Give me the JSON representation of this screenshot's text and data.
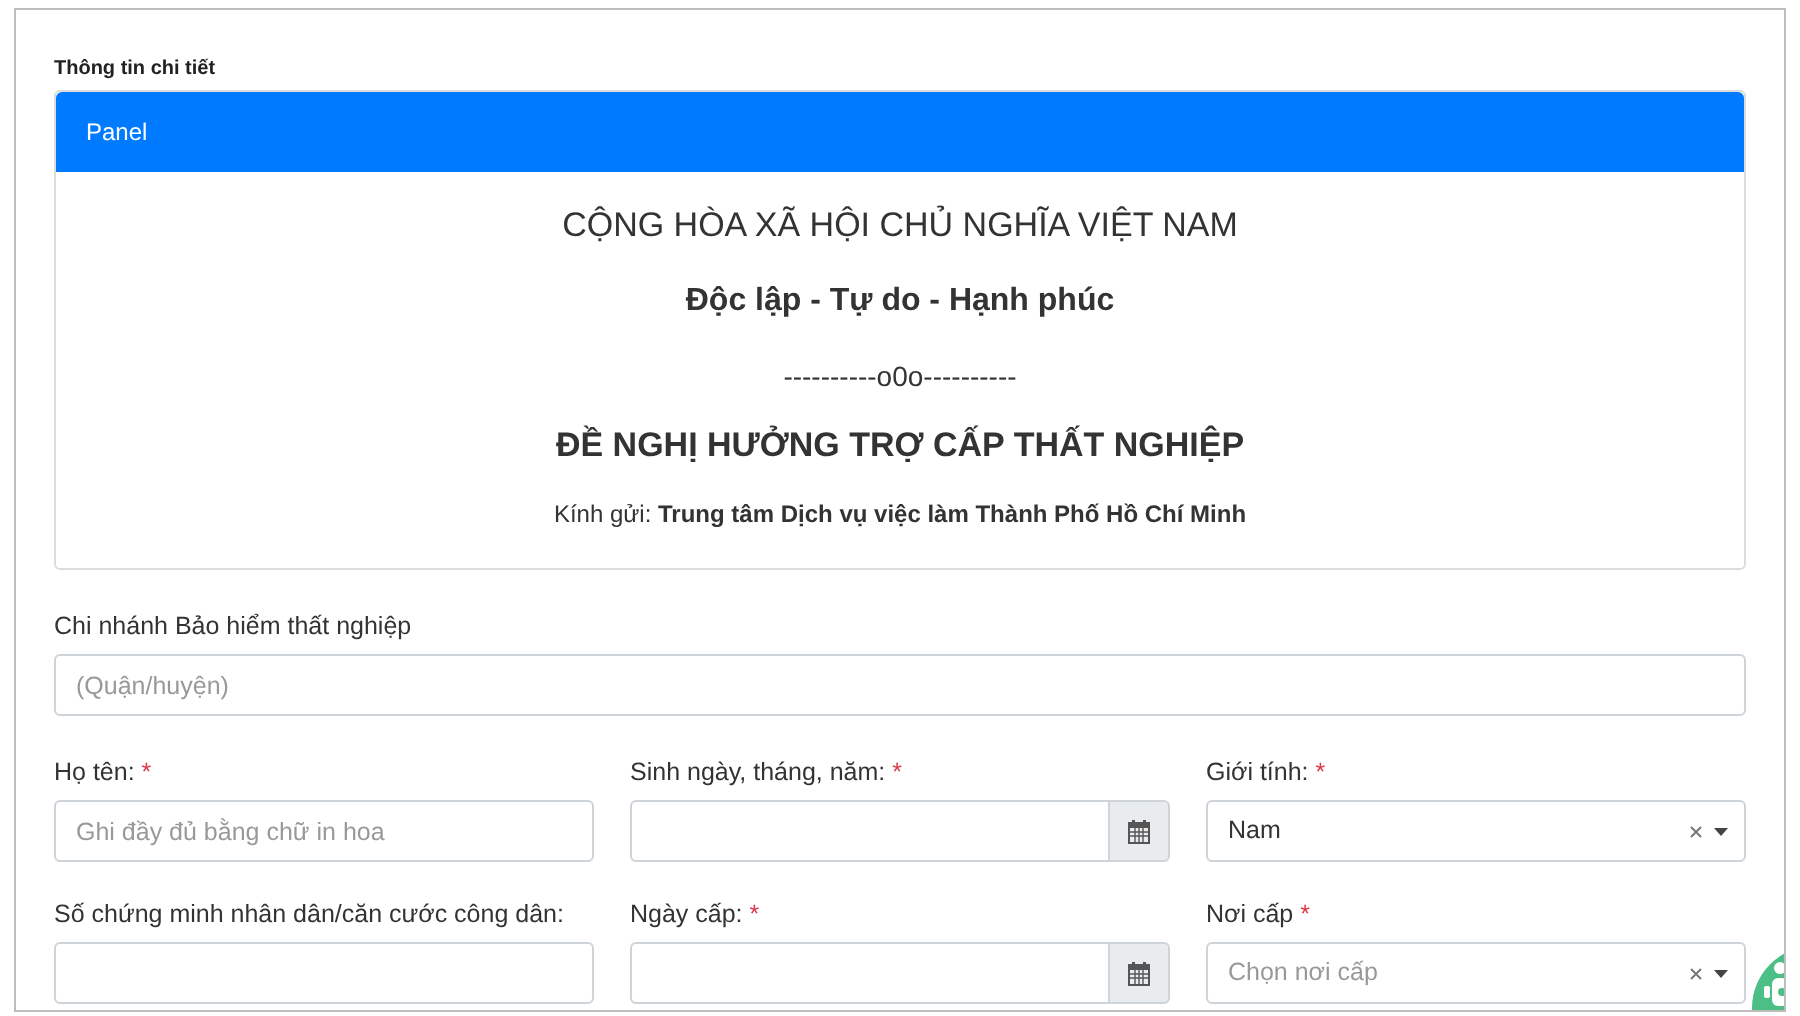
{
  "section_title": "Thông tin chi tiết",
  "panel": {
    "title": "Panel",
    "lines": [
      {
        "kind": "heading",
        "text": "CỘNG HÒA XÃ HỘI CHỦ NGHĨA VIỆT NAM"
      },
      {
        "kind": "motto",
        "text": "Độc lập - Tự do - Hạnh phúc"
      },
      {
        "kind": "divider",
        "text": "----------o0o----------"
      },
      {
        "kind": "title",
        "text": "ĐỀ NGHỊ HƯỞNG TRỢ CẤP THẤT NGHIỆP"
      },
      {
        "kind": "addressee",
        "text": "Kính gửi: **Trung tâm Dịch vụ việc làm Thành Phố Hồ Chí Minh**"
      }
    ]
  },
  "branch_field": {
    "label": "Chi nhánh Bảo hiểm thất nghiệp",
    "placeholder": "(Quận/huyện)"
  },
  "fields": [
    {
      "kind": "text",
      "label": "Họ tên:",
      "required_mark": "*",
      "placeholder": "Ghi đầy đủ bằng chữ in hoa"
    },
    {
      "kind": "date",
      "label": "Sinh ngày, tháng, năm:",
      "required_mark": "*"
    },
    {
      "kind": "select",
      "label": "Giới tính:",
      "required_mark": "*",
      "value": "Nam"
    },
    {
      "kind": "text",
      "label": "Số chứng minh nhân dân/căn cước công dân:"
    },
    {
      "kind": "date",
      "label": "Ngày cấp:",
      "required_mark": "*"
    },
    {
      "kind": "select",
      "label": "Nơi cấp",
      "required_mark": "*",
      "placeholder": "Chọn nơi cấp"
    }
  ]
}
